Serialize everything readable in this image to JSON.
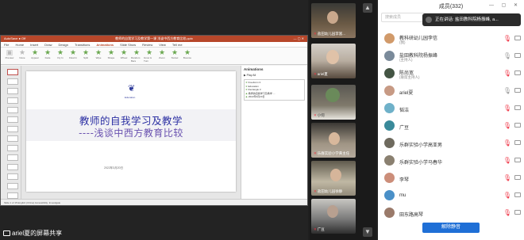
{
  "share": {
    "ppt_title": "教师的自我学习及教学第一课 浅谈中西方教育比较.pptx",
    "menu": [
      "File",
      "Home",
      "Insert",
      "Draw",
      "Design",
      "Transitions",
      "Animations",
      "Slide Show",
      "Review",
      "View",
      "Tell me"
    ],
    "active_menu": "Animations",
    "ribbon_effects": [
      "Preview",
      "None",
      "Appear",
      "Fade",
      "Fly In",
      "Float In",
      "Split",
      "Wipe",
      "Shape",
      "Wheel",
      "Random Bars",
      "Grow & Turn",
      "Zoom",
      "Swivel",
      "Bounce"
    ],
    "slide": {
      "logo_text": "Education",
      "title": "教师的自我学习及教学",
      "subtitle": "----浅谈中西方教育比较",
      "date": "2022年3月20日"
    },
    "anim_pane": {
      "title": "Animations",
      "play": "▶ Play All",
      "items": [
        "FreeForm 3",
        "Education",
        "Rectangle 3",
        "教师的自我学习及教学 ....",
        "2022年3月20日"
      ]
    },
    "status": "Slide 1 of 15   English (China)   Accessibility: Investigate",
    "share_label": "ariel夏的屏幕共享"
  },
  "videos": [
    {
      "name": "盐田幼儿园李富... ",
      "muted": true
    },
    {
      "name": "ariel夏",
      "muted": true
    },
    {
      "name": "小何",
      "muted": true
    },
    {
      "name": "乐群实验小学黄主任",
      "muted": true
    },
    {
      "name": "盐田幼儿园徐静",
      "muted": true
    },
    {
      "name": "广豆",
      "muted": true
    }
  ],
  "panel": {
    "title": "成员(332)",
    "search_placeholder": "搜索成员",
    "speaking": "正在讲话: 盐田教科院杨振峰, a...",
    "members": [
      {
        "name": "教科研幼儿园李信",
        "role": "(我)",
        "color": "#d19a6a",
        "mic_muted": true
      },
      {
        "name": "盐田教科院杨振峰",
        "role": "(主持人)",
        "color": "#7a8a9a",
        "mic_muted": false
      },
      {
        "name": "陈尚宽",
        "role": "(联席主持人)",
        "color": "#445544",
        "mic_muted": true
      },
      {
        "name": "ariel夏",
        "role": "",
        "color": "#c79a84",
        "mic_muted": false
      },
      {
        "name": "韬洁",
        "role": "",
        "color": "#6fb1c9",
        "mic_muted": true
      },
      {
        "name": "广豆",
        "role": "",
        "color": "#3a8a9a",
        "mic_muted": true
      },
      {
        "name": "乐群实验小学高亚男",
        "role": "",
        "color": "#6e6a5e",
        "mic_muted": true
      },
      {
        "name": "乐群实验小学马春华",
        "role": "",
        "color": "#8a8070",
        "mic_muted": true
      },
      {
        "name": "李琴",
        "role": "",
        "color": "#cc8e7a",
        "mic_muted": true
      },
      {
        "name": "mu",
        "role": "",
        "color": "#4a90c8",
        "mic_muted": true
      },
      {
        "name": "田东路高琴",
        "role": "",
        "color": "#9a7a6a",
        "mic_muted": true
      }
    ],
    "footer_button": "解除静音"
  }
}
